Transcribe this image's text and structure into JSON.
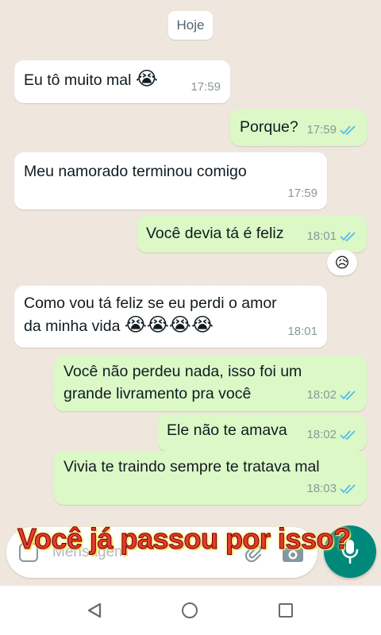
{
  "date_chip": "Hoje",
  "messages": [
    {
      "direction": "in",
      "text": "Eu tô muito mal",
      "emoji": "😭",
      "time": "17:59"
    },
    {
      "direction": "out",
      "text": "Porque?",
      "time": "17:59",
      "status": "read"
    },
    {
      "direction": "in",
      "text": "Meu namorado terminou comigo",
      "time": "17:59"
    },
    {
      "direction": "out",
      "text": "Você devia tá é feliz",
      "time": "18:01",
      "status": "read",
      "reaction": "😥"
    },
    {
      "direction": "in",
      "line1": "Como vou tá feliz se eu perdi o amor",
      "line2": "da minha vida",
      "emoji": "😭😭😭😭",
      "time": "18:01"
    },
    {
      "direction": "out",
      "line1": "Você não perdeu nada, isso foi um",
      "line2": "grande livramento pra você",
      "time": "18:02",
      "status": "read"
    },
    {
      "direction": "out",
      "text": "Ele não te amava",
      "time": "18:02",
      "status": "read"
    },
    {
      "direction": "out",
      "text": "Vivia te traindo sempre te tratava mal",
      "time": "18:03",
      "status": "read"
    }
  ],
  "composer": {
    "placeholder": "Mensagem"
  },
  "caption": "Você já passou por isso?",
  "colors": {
    "outgoing_bubble": "#dcf8c6",
    "incoming_bubble": "#ffffff",
    "read_ticks": "#53bdeb",
    "mic_button": "#00897b",
    "caption": "#e53935"
  },
  "icons": [
    "emoji-icon",
    "attach-icon",
    "camera-icon",
    "mic-icon",
    "back-icon",
    "home-icon",
    "recents-icon"
  ]
}
